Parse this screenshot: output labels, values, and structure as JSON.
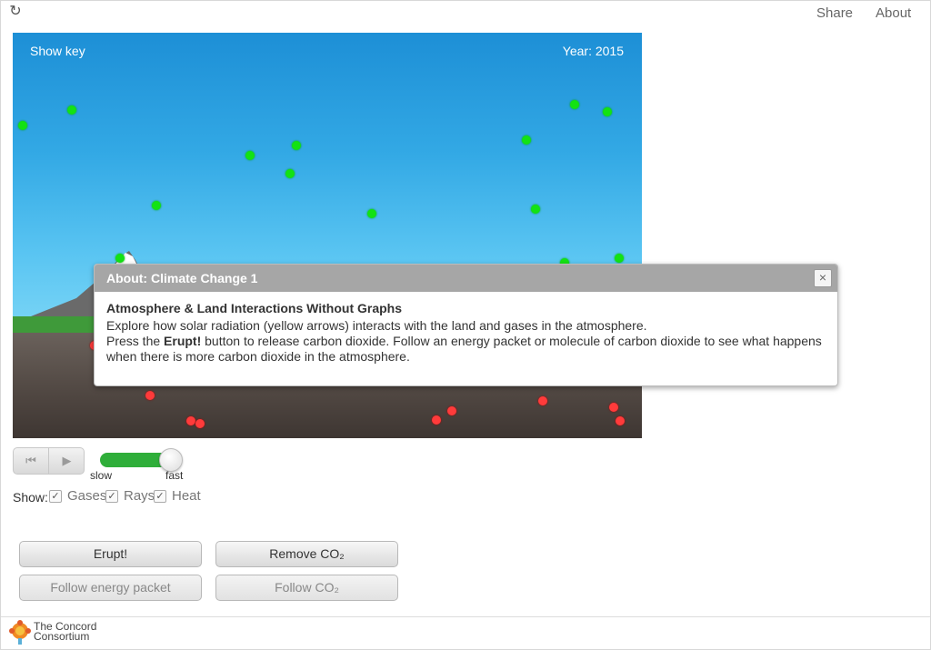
{
  "topbar": {
    "reload_icon": "reload-icon",
    "share": "Share",
    "about": "About"
  },
  "sim": {
    "show_key": "Show key",
    "year": "Year: 2015",
    "colors": {
      "sky_top": "#1d8fd6",
      "sky_bottom": "#74d2f5",
      "ground": "#4f4641",
      "gas_green": "#13e213",
      "gas_red": "#ff3b3b"
    }
  },
  "dialog": {
    "title": "About: Climate Change 1",
    "close": "×",
    "heading": "Atmosphere & Land Interactions Without Graphs",
    "line1": "Explore how solar radiation (yellow arrows) interacts with the land and gases in the atmosphere.",
    "line2_pre": "Press the ",
    "line2_bold": "Erupt!",
    "line2_post": " button to release carbon dioxide. Follow an energy packet or molecule of carbon dioxide to see what happens when there is more carbon dioxide in the atmosphere."
  },
  "controls": {
    "reset_icon": "⏮",
    "play_icon": "▶",
    "speed": {
      "slow": "slow",
      "fast": "fast",
      "level": 1.0
    },
    "show": {
      "label": "Show:",
      "items": [
        {
          "label": "Gases",
          "checked": true
        },
        {
          "label": "Rays",
          "checked": true
        },
        {
          "label": "Heat",
          "checked": true
        }
      ]
    }
  },
  "buttons": {
    "erupt": "Erupt!",
    "remove": "Remove CO₂",
    "follow_energy": "Follow energy packet",
    "follow_co2": "Follow CO₂"
  },
  "footer": {
    "logo_line1": "The Concord",
    "logo_line2": "Consortium"
  }
}
